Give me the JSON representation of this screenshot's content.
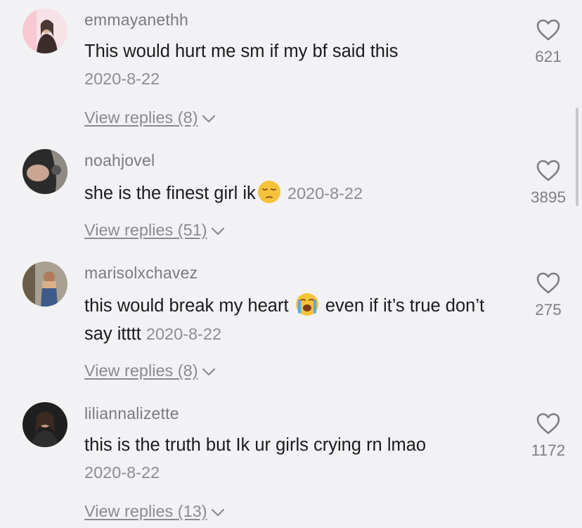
{
  "comments": [
    {
      "username": "emmayanethh",
      "text": "This would hurt me sm if my bf said this",
      "date": "2020-8-22",
      "replies": "View replies (8)",
      "likes": "621",
      "avatar_icon": "user-avatar-pink"
    },
    {
      "username": "noahjovel",
      "text": "she is the finest girl ik",
      "emoji": "pensive-face-emoji",
      "date": "2020-8-22",
      "replies": "View replies (51)",
      "likes": "3895",
      "avatar_icon": "user-avatar-dark"
    },
    {
      "username": "marisolxchavez",
      "text": "this would break my heart",
      "emoji": "loudly-crying-face-emoji",
      "text_after": "even if it’s true don’t say itttt",
      "date": "2020-8-22",
      "replies": "View replies (8)",
      "likes": "275",
      "avatar_icon": "user-avatar-photo"
    },
    {
      "username": "liliannalizette",
      "text": "this is the truth but Ik ur girls crying rn lmao",
      "date": "2020-8-22",
      "replies": "View replies (13)",
      "likes": "1172",
      "avatar_icon": "user-avatar-dark"
    }
  ],
  "colors": {
    "background": "#f2f2f4",
    "username": "#7a7a80",
    "text": "#1b1b1d",
    "secondary": "#8a8a8f"
  }
}
